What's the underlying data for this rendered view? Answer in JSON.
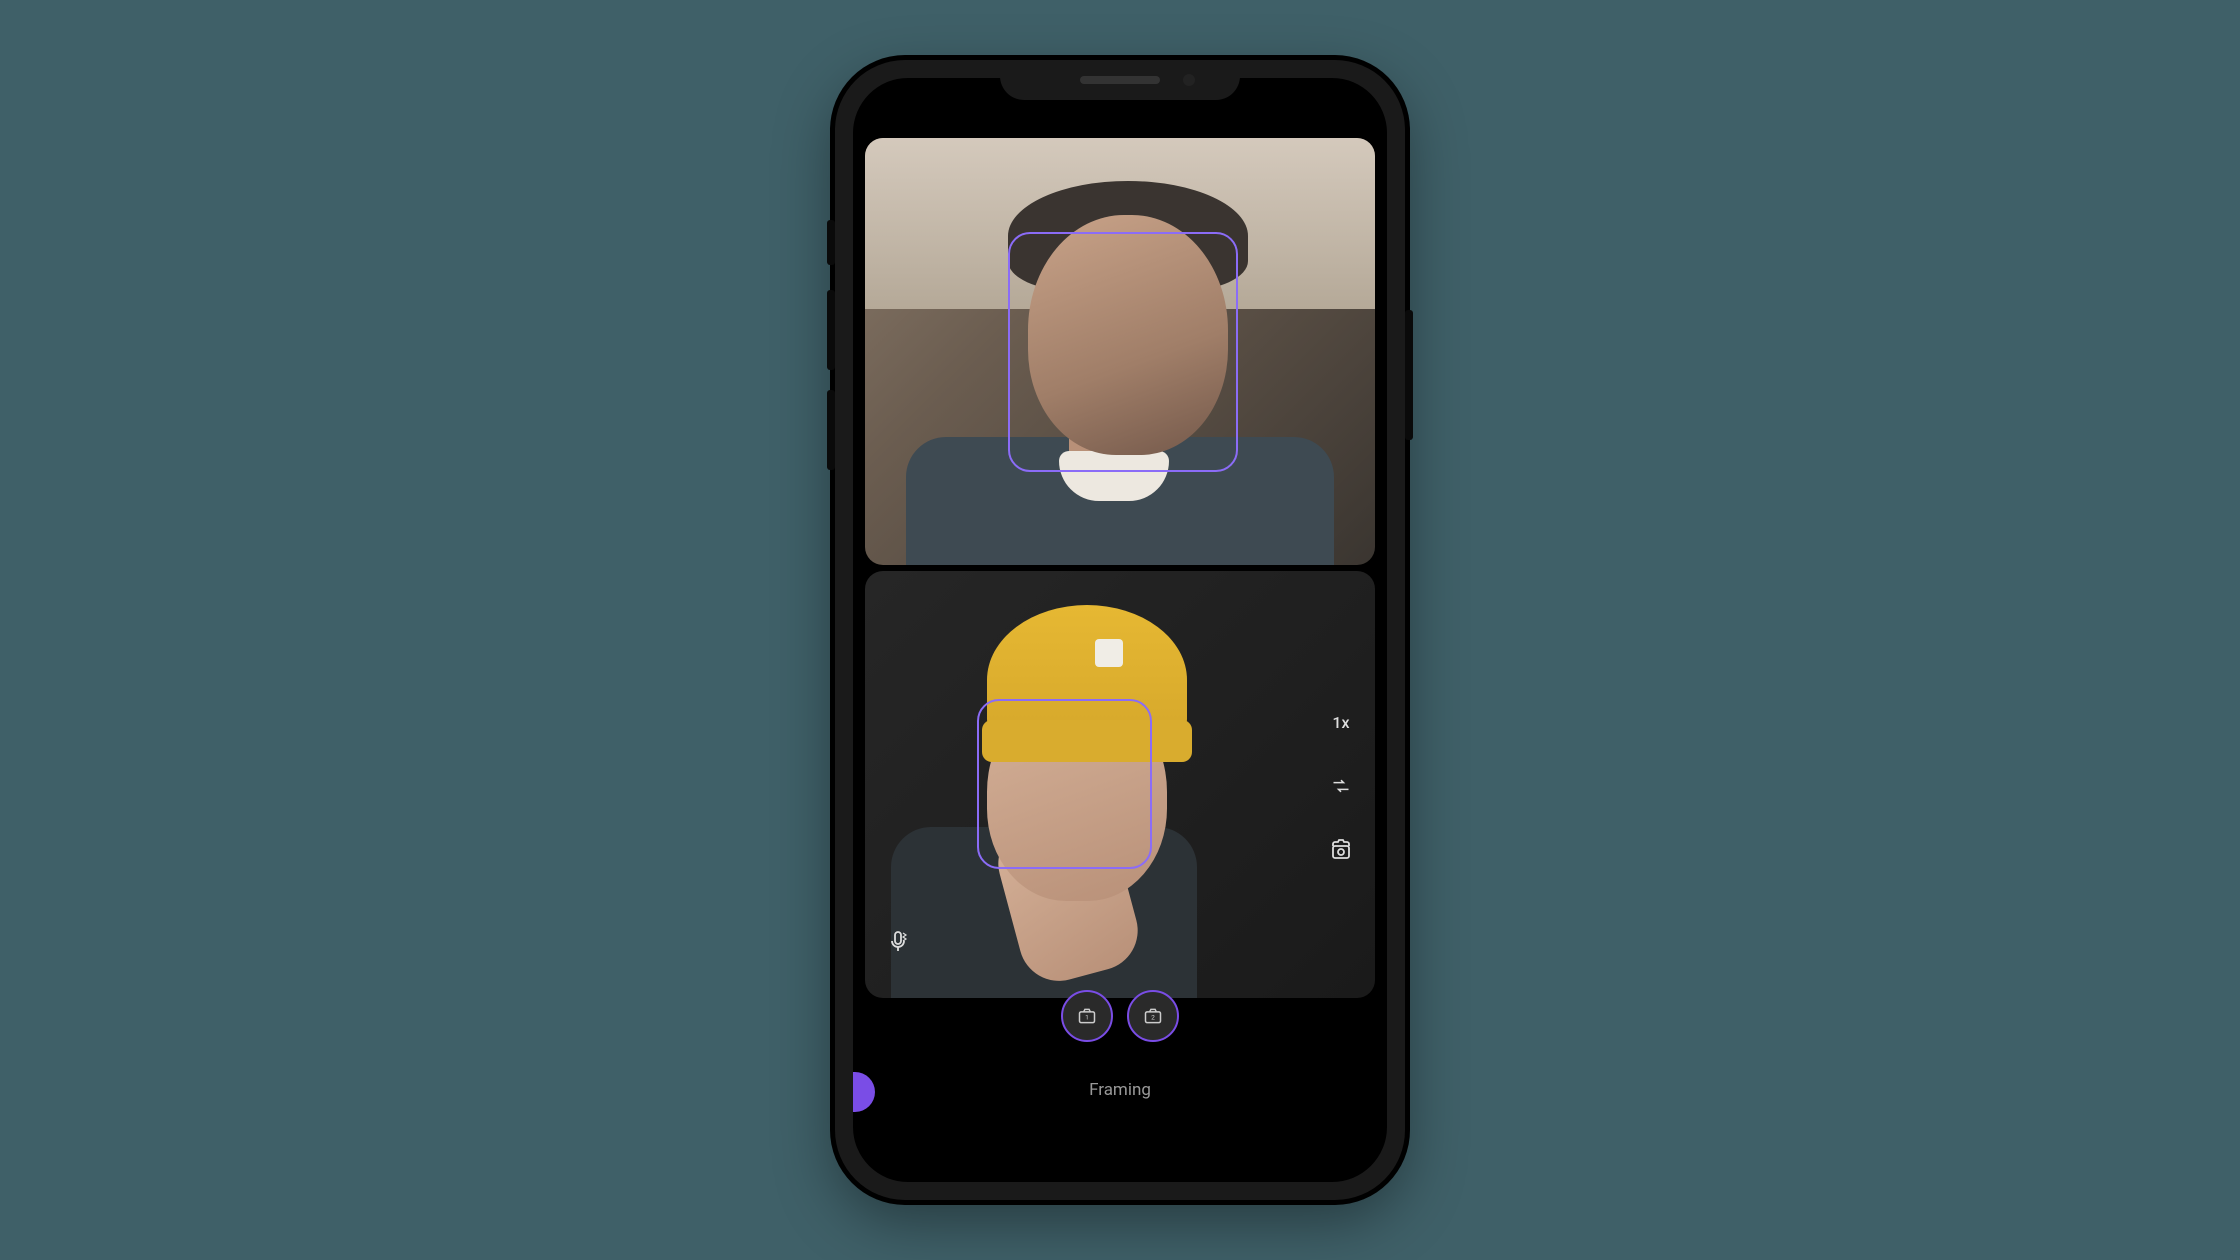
{
  "app": {
    "mode_label": "Framing"
  },
  "controls": {
    "zoom_level": "1x",
    "mic_icon": "mic-bluetooth-icon",
    "swap_icon": "swap-cameras-icon",
    "switch_icon": "flip-camera-icon",
    "cam1_icon": "camera-1-icon",
    "cam2_icon": "camera-2-icon"
  },
  "feeds": {
    "feed1": {
      "has_face_frame": true
    },
    "feed2": {
      "has_face_frame": true
    }
  },
  "colors": {
    "accent": "#7a4de6",
    "frame": "#8b6cf7"
  }
}
